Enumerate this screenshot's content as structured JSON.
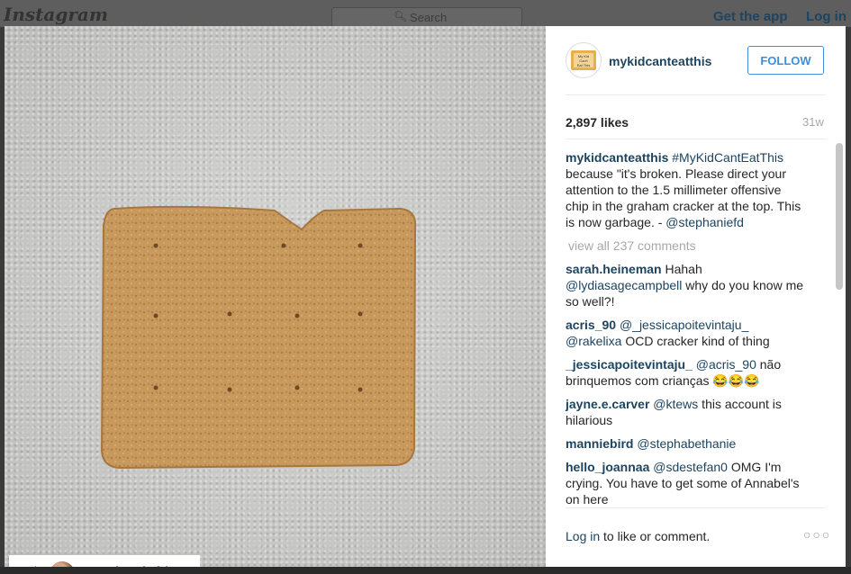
{
  "topbar": {
    "logo": "Instagram",
    "search_placeholder": "Search",
    "get_app": "Get the app",
    "login": "Log in"
  },
  "post": {
    "username": "mykidcanteatthis",
    "follow": "FOLLOW",
    "likes": "2,897 likes",
    "time": "31w",
    "caption_hashtag": "#MyKidCantEatThis",
    "caption_text": "because \"it's broken. Please direct your attention to the 1.5 millimeter offensive chip in the graham cracker at the top. This is now garbage. - ",
    "caption_mention": "@stephaniefd",
    "view_all": "view all 237 comments",
    "repost_user": "stephaniefd"
  },
  "comments": [
    {
      "user": "sarah.heineman",
      "pre": " Hahah ",
      "mention": "@lydiasagecampbell",
      "post": " why do you know me so well?!"
    },
    {
      "user": "acris_90",
      "pre": " ",
      "mention": "@_jessicapoitevintaju_ @rakelixa",
      "post": " OCD cracker kind of thing"
    },
    {
      "user": "_jessicapoitevintaju_",
      "pre": " ",
      "mention": "@acris_90",
      "post": " não brinquemos com crianças 😂😂😂"
    },
    {
      "user": "jayne.e.carver",
      "pre": " ",
      "mention": "@ktews",
      "post": " this account is hilarious"
    },
    {
      "user": "manniebird",
      "pre": " ",
      "mention": "@stephabethanie",
      "post": ""
    },
    {
      "user": "hello_joannaa",
      "pre": " ",
      "mention": "@sdestefan0",
      "post": " OMG I'm crying. You have to get some of Annabel's on here"
    }
  ],
  "footer": {
    "login_link": "Log in",
    "login_rest": " to like or comment.",
    "more": "○○○"
  },
  "avatar_text": [
    "My Kid",
    "Can't",
    "Eat This"
  ],
  "colors": {
    "link": "#1d4460",
    "follow_blue": "#3f8fd8",
    "cracker": "#c79a5e"
  }
}
